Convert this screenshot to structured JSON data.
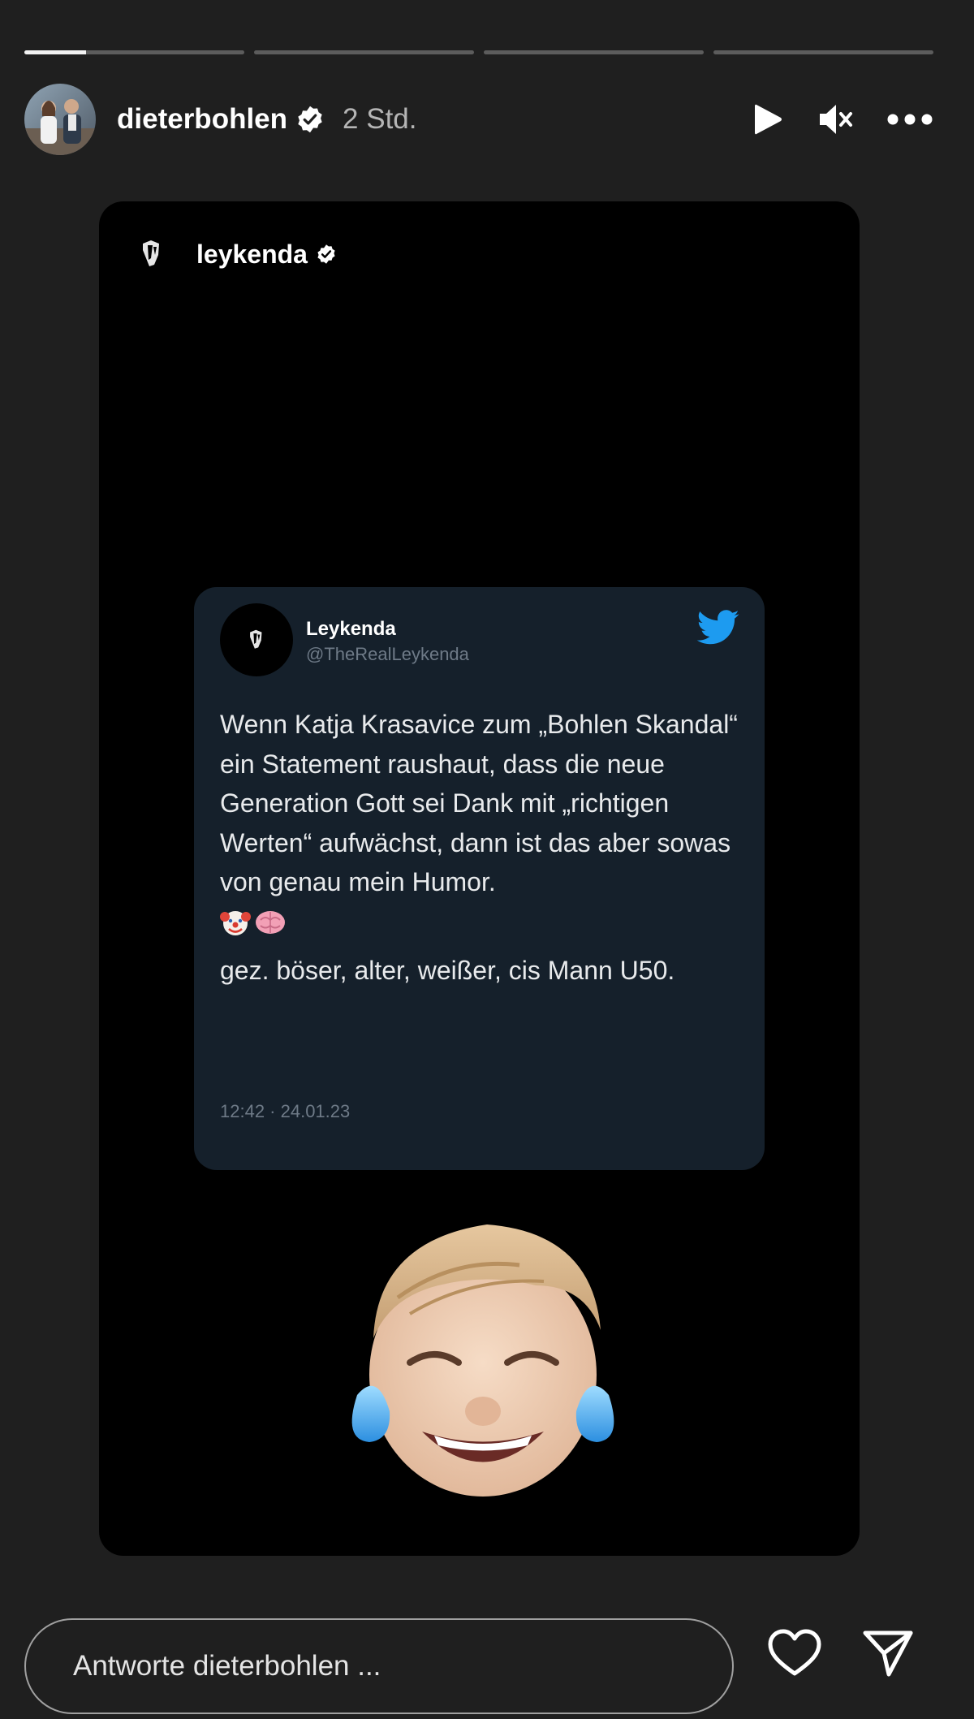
{
  "progress": {
    "segments": 4,
    "active_segment_fill": 0.28
  },
  "header": {
    "username": "dieterbohlen",
    "time_ago": "2 Std.",
    "icons": [
      "verified-badge-icon",
      "play-icon",
      "mute-icon",
      "more-icon"
    ]
  },
  "story": {
    "source_account": "leykenda",
    "tweet": {
      "name": "Leykenda",
      "handle": "@TheRealLeykenda",
      "body_text": "Wenn Katja Krasavice zum „Bohlen Skandal“ ein Statement raushaut, dass die neue Generation Gott sei Dank mit „richtigen Werten“ aufwächst, dann ist das aber sowas von genau mein Humor.",
      "emojis": [
        "clown-face-emoji",
        "brain-emoji"
      ],
      "signature": "gez. böser, alter, weißer, cis Mann U50.",
      "timestamp": "12:42 · 24.01.23"
    }
  },
  "reply": {
    "placeholder": "Antworte dieterbohlen ..."
  },
  "colors": {
    "background": "#1f1f1f",
    "story_background": "#000000",
    "tweet_card": "#15202b",
    "twitter_blue": "#1d9bf0",
    "muted_text": "#6e7a87"
  }
}
